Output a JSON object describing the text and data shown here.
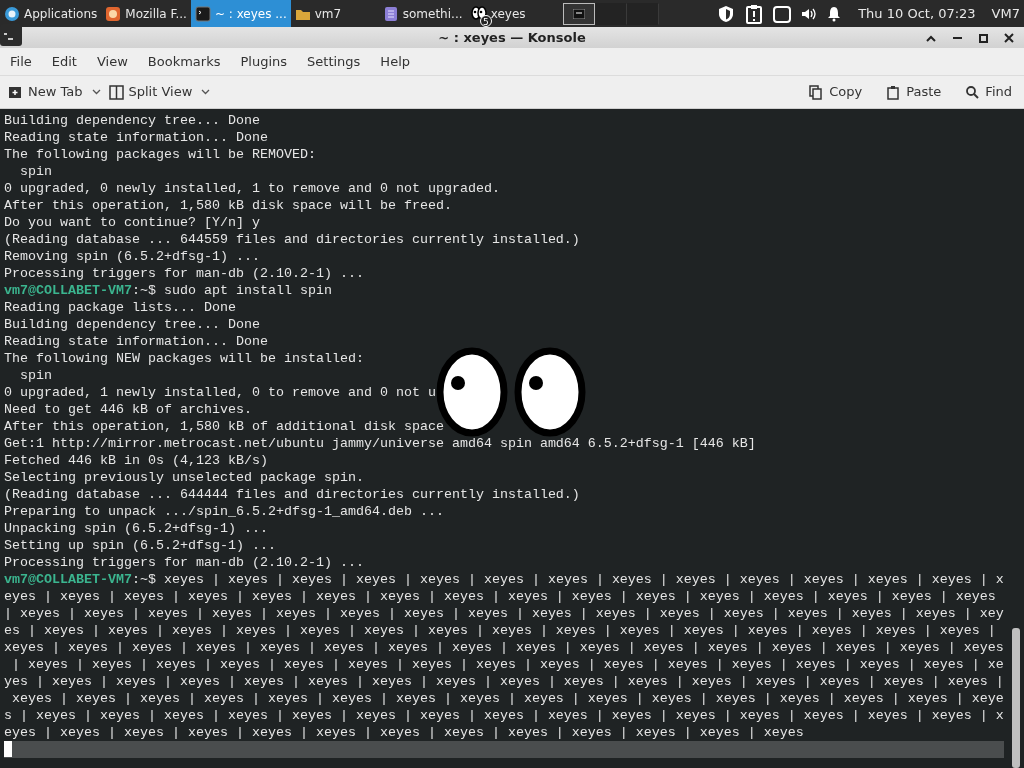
{
  "taskbar": {
    "items": [
      {
        "kind": "apps",
        "label": "Applications",
        "selected": false
      },
      {
        "kind": "browser",
        "label": "Mozilla F...",
        "selected": false
      },
      {
        "kind": "terminal",
        "label": "~ : xeyes ...",
        "selected": true
      },
      {
        "kind": "folder",
        "label": "vm7",
        "selected": false
      },
      {
        "kind": "document",
        "label": "somethi...",
        "selected": false
      },
      {
        "kind": "eyes",
        "label": "xeyes",
        "badge": "5",
        "selected": false
      }
    ],
    "workspaces": [
      {
        "selected": true
      },
      {
        "selected": false
      },
      {
        "selected": false
      }
    ],
    "clock": "Thu 10 Oct, 07:23",
    "user": "VM7"
  },
  "window": {
    "title": "~ : xeyes — Konsole"
  },
  "menu": [
    "File",
    "Edit",
    "View",
    "Bookmarks",
    "Plugins",
    "Settings",
    "Help"
  ],
  "toolbar": {
    "left": [
      {
        "kind": "newtab",
        "label": "New Tab"
      },
      {
        "kind": "split",
        "label": "Split View"
      }
    ],
    "right": [
      {
        "kind": "copy",
        "label": "Copy"
      },
      {
        "kind": "paste",
        "label": "Paste"
      },
      {
        "kind": "find",
        "label": "Find"
      }
    ]
  },
  "terminal": {
    "lines": [
      {
        "text": "Building dependency tree... Done"
      },
      {
        "text": "Reading state information... Done"
      },
      {
        "text": "The following packages will be REMOVED:"
      },
      {
        "text": "  spin"
      },
      {
        "text": "0 upgraded, 0 newly installed, 1 to remove and 0 not upgraded."
      },
      {
        "text": "After this operation, 1,580 kB disk space will be freed."
      },
      {
        "text": "Do you want to continue? [Y/n] y"
      },
      {
        "text": "(Reading database ... 644559 files and directories currently installed.)"
      },
      {
        "text": "Removing spin (6.5.2+dfsg-1) ..."
      },
      {
        "text": "Processing triggers for man-db (2.10.2-1) ..."
      },
      {
        "prompt": "vm7@COLLABET-VM7",
        "text": ":~$ sudo apt install spin"
      },
      {
        "text": "Reading package lists... Done"
      },
      {
        "text": "Building dependency tree... Done"
      },
      {
        "text": "Reading state information... Done"
      },
      {
        "text": "The following NEW packages will be installed:"
      },
      {
        "text": "  spin"
      },
      {
        "text": "0 upgraded, 1 newly installed, 0 to remove and 0 not u"
      },
      {
        "text": "Need to get 446 kB of archives."
      },
      {
        "text": "After this operation, 1,580 kB of additional disk space"
      },
      {
        "text": "Get:1 http://mirror.metrocast.net/ubuntu jammy/universe amd64 spin amd64 6.5.2+dfsg-1 [446 kB]"
      },
      {
        "text": "Fetched 446 kB in 0s (4,123 kB/s)"
      },
      {
        "text": "Selecting previously unselected package spin."
      },
      {
        "text": "(Reading database ... 644444 files and directories currently installed.)"
      },
      {
        "text": "Preparing to unpack .../spin_6.5.2+dfsg-1_amd64.deb ..."
      },
      {
        "text": "Unpacking spin (6.5.2+dfsg-1) ..."
      },
      {
        "text": "Setting up spin (6.5.2+dfsg-1) ..."
      },
      {
        "text": "Processing triggers for man-db (2.10.2-1) ..."
      },
      {
        "prompt": "vm7@COLLABET-VM7",
        "text": ":~$ xeyes | xeyes | xeyes | xeyes | xeyes | xeyes | xeyes | xeyes | xeyes | xeyes | xeyes | xeyes | xeyes | x"
      },
      {
        "text": "eyes | xeyes | xeyes | xeyes | xeyes | xeyes | xeyes | xeyes | xeyes | xeyes | xeyes | xeyes | xeyes | xeyes | xeyes | xeyes"
      },
      {
        "text": "| xeyes | xeyes | xeyes | xeyes | xeyes | xeyes | xeyes | xeyes | xeyes | xeyes | xeyes | xeyes | xeyes | xeyes | xeyes | xey"
      },
      {
        "text": "es | xeyes | xeyes | xeyes | xeyes | xeyes | xeyes | xeyes | xeyes | xeyes | xeyes | xeyes | xeyes | xeyes | xeyes | xeyes |"
      },
      {
        "text": "xeyes | xeyes | xeyes | xeyes | xeyes | xeyes | xeyes | xeyes | xeyes | xeyes | xeyes | xeyes | xeyes | xeyes | xeyes | xeyes"
      },
      {
        "text": " | xeyes | xeyes | xeyes | xeyes | xeyes | xeyes | xeyes | xeyes | xeyes | xeyes | xeyes | xeyes | xeyes | xeyes | xeyes | xe"
      },
      {
        "text": "yes | xeyes | xeyes | xeyes | xeyes | xeyes | xeyes | xeyes | xeyes | xeyes | xeyes | xeyes | xeyes | xeyes | xeyes | xeyes |"
      },
      {
        "text": " xeyes | xeyes | xeyes | xeyes | xeyes | xeyes | xeyes | xeyes | xeyes | xeyes | xeyes | xeyes | xeyes | xeyes | xeyes | xeye"
      },
      {
        "text": "s | xeyes | xeyes | xeyes | xeyes | xeyes | xeyes | xeyes | xeyes | xeyes | xeyes | xeyes | xeyes | xeyes | xeyes | xeyes | x"
      },
      {
        "text": "eyes | xeyes | xeyes | xeyes | xeyes | xeyes | xeyes | xeyes | xeyes | xeyes | xeyes | xeyes | xeyes"
      }
    ]
  }
}
